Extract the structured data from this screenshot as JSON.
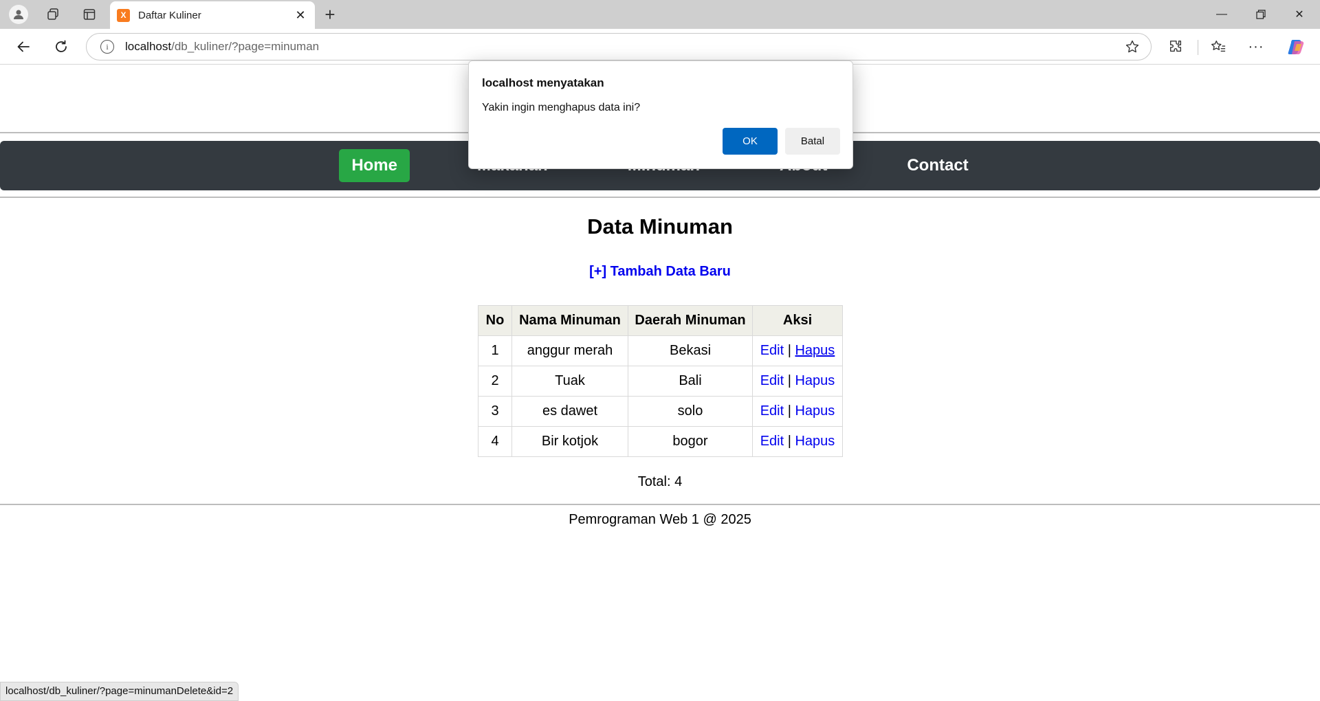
{
  "browser": {
    "tab_title": "Daftar Kuliner",
    "favicon_label": "X",
    "url_host": "localhost",
    "url_path": "/db_kuliner/?page=minuman",
    "status_url": "localhost/db_kuliner/?page=minumanDelete&id=2"
  },
  "nav": {
    "items": [
      "Home",
      "Makanan",
      "Minuman",
      "About",
      "Contact"
    ],
    "active_color": "#28a745",
    "bar_color": "#343a40"
  },
  "page": {
    "title": "Data Minuman",
    "add_link": "[+] Tambah Data Baru",
    "table": {
      "headers": [
        "No",
        "Nama Minuman",
        "Daerah Minuman",
        "Aksi"
      ],
      "rows": [
        {
          "no": "1",
          "nama": "anggur merah",
          "daerah": "Bekasi"
        },
        {
          "no": "2",
          "nama": "Tuak",
          "daerah": "Bali"
        },
        {
          "no": "3",
          "nama": "es dawet",
          "daerah": "solo"
        },
        {
          "no": "4",
          "nama": "Bir kotjok",
          "daerah": "bogor"
        }
      ],
      "edit_label": "Edit",
      "delete_label": "Hapus",
      "separator": "|"
    },
    "total": "Total: 4",
    "footer": "Pemrograman Web 1 @ 2025"
  },
  "dialog": {
    "title": "localhost menyatakan",
    "message": "Yakin ingin menghapus data ini?",
    "ok_label": "OK",
    "cancel_label": "Batal",
    "ok_color": "#0067c0"
  }
}
